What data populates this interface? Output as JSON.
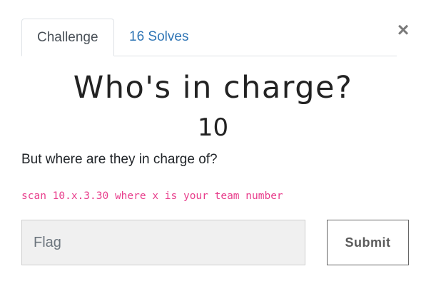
{
  "tabs": [
    {
      "label": "Challenge",
      "active": true
    },
    {
      "label": "16 Solves",
      "active": false
    }
  ],
  "close": {
    "glyph": "×"
  },
  "challenge": {
    "name": "Who's in charge?",
    "points": "10",
    "description": "But where are they in charge of?",
    "code_hint": "scan 10.x.3.30 where x is your team number"
  },
  "form": {
    "flag_placeholder": "Flag",
    "flag_value": "",
    "submit_label": "Submit"
  },
  "colors": {
    "link": "#2f75b5",
    "code": "#e83e8c",
    "input_bg": "#f0f0f0"
  }
}
